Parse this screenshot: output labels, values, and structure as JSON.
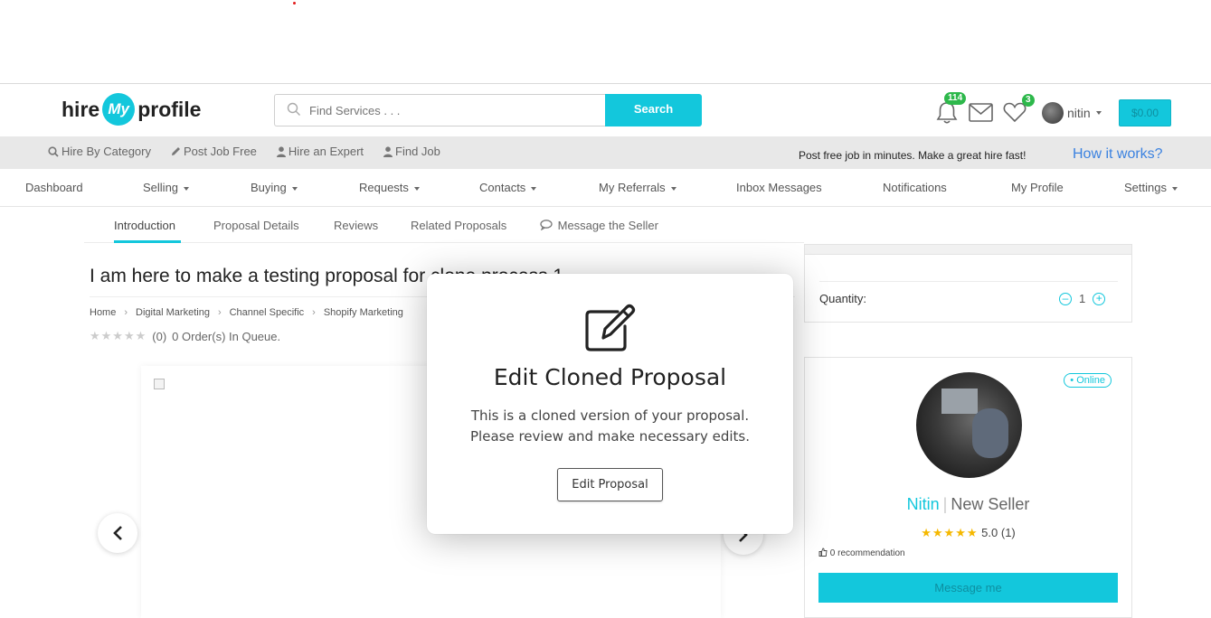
{
  "header": {
    "logo_left": "hire",
    "logo_mid": "My",
    "logo_right": "profile",
    "search_placeholder": "Find Services . . .",
    "search_button": "Search",
    "notifications_count": "114",
    "favorites_count": "3",
    "user_name": "nitin",
    "cart_total": "$0.00",
    "icons": [
      "search-icon",
      "bell-icon",
      "envelope-icon",
      "heart-icon"
    ]
  },
  "graybar": {
    "links": [
      "Hire By Category",
      "Post Job Free",
      "Hire an Expert",
      "Find Job"
    ],
    "link_icons": [
      "search-icon",
      "pencil-icon",
      "user-icon",
      "user-icon"
    ],
    "tagline": "Post free job in minutes. Make a great hire fast!",
    "how_it_works": "How it works?"
  },
  "nav": {
    "items": [
      "Dashboard",
      "Selling",
      "Buying",
      "Requests",
      "Contacts",
      "My Referrals",
      "Inbox Messages",
      "Notifications",
      "My Profile",
      "Settings"
    ]
  },
  "tabs": {
    "items": [
      "Introduction",
      "Proposal Details",
      "Reviews",
      "Related Proposals",
      "Message the Seller"
    ],
    "active": "Introduction"
  },
  "proposal": {
    "title": "I am here to make a testing proposal for clone process 1",
    "breadcrumbs": [
      "Home",
      "Digital Marketing",
      "Channel Specific",
      "Shopify Marketing"
    ],
    "stars": "★★★★★",
    "reviews_count": "(0)",
    "queue": "0 Order(s) In Queue."
  },
  "order": {
    "quantity_label": "Quantity:",
    "quantity_value": "1"
  },
  "seller": {
    "status": "• Online",
    "name": "Nitin",
    "level": "New Seller",
    "stars": "★★★★★",
    "rating": "5.0",
    "rating_count": "(1)",
    "recommendation": "0 recommendation",
    "message_button": "Message me"
  },
  "modal": {
    "title": "Edit Cloned Proposal",
    "line1": "This is a cloned version of your proposal.",
    "line2": "Please review and make necessary edits.",
    "button": "Edit Proposal",
    "icon": "edit-icon"
  },
  "colors": {
    "brand": "#13c7dc",
    "badge": "#2db84b",
    "link": "#3b82e0",
    "star": "#f5b800"
  }
}
